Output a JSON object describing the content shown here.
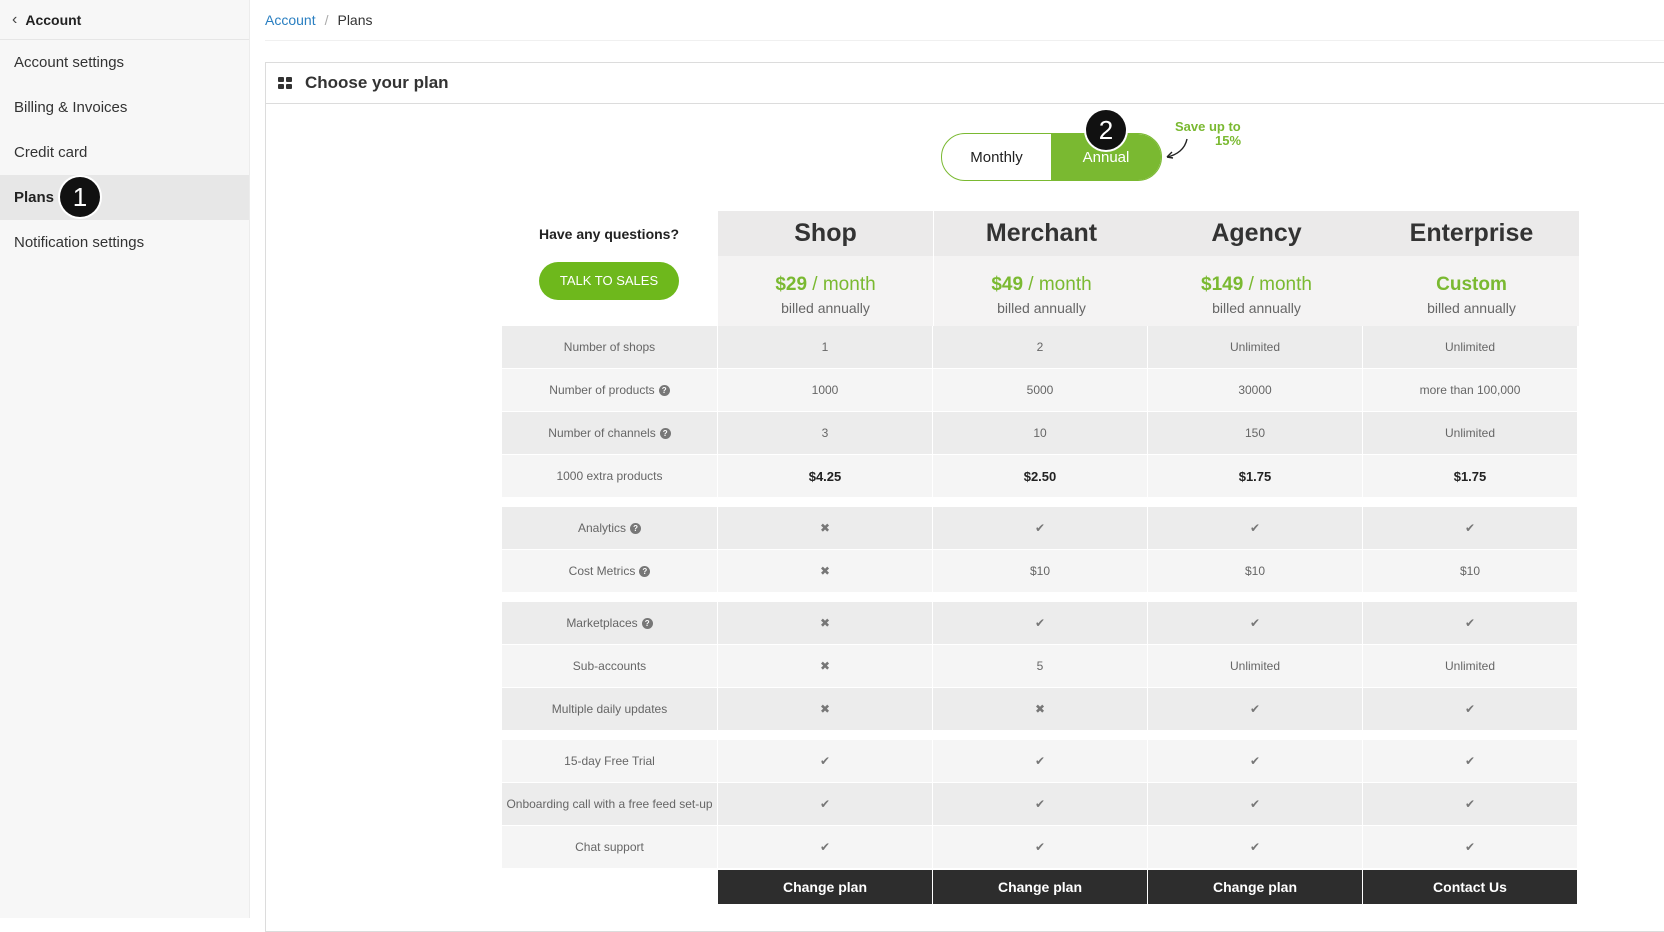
{
  "sidebar": {
    "header": "Account",
    "items": [
      {
        "label": "Account settings"
      },
      {
        "label": "Billing & Invoices"
      },
      {
        "label": "Credit card"
      },
      {
        "label": "Plans"
      },
      {
        "label": "Notification settings"
      }
    ],
    "active_index": 3
  },
  "markers": {
    "one": "1",
    "two": "2"
  },
  "breadcrumb": {
    "root": "Account",
    "separator": "/",
    "current": "Plans"
  },
  "panel": {
    "title": "Choose your plan"
  },
  "billing_toggle": {
    "monthly": "Monthly",
    "annual": "Annual",
    "selected": "Annual",
    "save_line1": "Save up to",
    "save_line2": "15%"
  },
  "questions": {
    "title": "Have any questions?",
    "button": "TALK TO SALES"
  },
  "plans": [
    {
      "name": "Shop",
      "price": "$29",
      "period": " / month",
      "billed": "billed annually",
      "action": "Change plan"
    },
    {
      "name": "Merchant",
      "price": "$49",
      "period": " / month",
      "billed": "billed annually",
      "action": "Change plan"
    },
    {
      "name": "Agency",
      "price": "$149",
      "period": " / month",
      "billed": "billed annually",
      "action": "Change plan"
    },
    {
      "name": "Enterprise",
      "price": "Custom",
      "period": "",
      "billed": "billed annually",
      "action": "Contact Us"
    }
  ],
  "features": [
    {
      "label": "Number of shops",
      "help": false,
      "values": [
        "1",
        "2",
        "Unlimited",
        "Unlimited"
      ]
    },
    {
      "label": "Number of products",
      "help": true,
      "values": [
        "1000",
        "5000",
        "30000",
        "more than 100,000"
      ]
    },
    {
      "label": "Number of channels",
      "help": true,
      "values": [
        "3",
        "10",
        "150",
        "Unlimited"
      ]
    },
    {
      "label": "1000 extra products",
      "help": false,
      "bold": true,
      "values": [
        "$4.25",
        "$2.50",
        "$1.75",
        "$1.75"
      ]
    },
    {
      "label": "Analytics",
      "help": true,
      "values": [
        "✖",
        "✔",
        "✔",
        "✔"
      ]
    },
    {
      "label": "Cost Metrics",
      "help": true,
      "values": [
        "✖",
        "$10",
        "$10",
        "$10"
      ]
    },
    {
      "label": "Marketplaces",
      "help": true,
      "values": [
        "✖",
        "✔",
        "✔",
        "✔"
      ]
    },
    {
      "label": "Sub-accounts",
      "help": false,
      "values": [
        "✖",
        "5",
        "Unlimited",
        "Unlimited"
      ]
    },
    {
      "label": "Multiple daily updates",
      "help": false,
      "values": [
        "✖",
        "✖",
        "✔",
        "✔"
      ]
    },
    {
      "label": "15-day Free Trial",
      "help": false,
      "values": [
        "✔",
        "✔",
        "✔",
        "✔"
      ]
    },
    {
      "label": "Onboarding call with a free feed set-up",
      "help": false,
      "values": [
        "✔",
        "✔",
        "✔",
        "✔"
      ]
    },
    {
      "label": "Chat support",
      "help": false,
      "values": [
        "✔",
        "✔",
        "✔",
        "✔"
      ]
    }
  ],
  "colors": {
    "accent": "#7ab931",
    "button_green": "#6eb81c",
    "dark_button": "#2d2d2d",
    "link": "#2a7fc1"
  },
  "icons": {
    "back": "chevron-left-icon",
    "panel": "grid-icon",
    "help": "question-circle-icon",
    "yes": "check-icon",
    "no": "cross-icon"
  }
}
